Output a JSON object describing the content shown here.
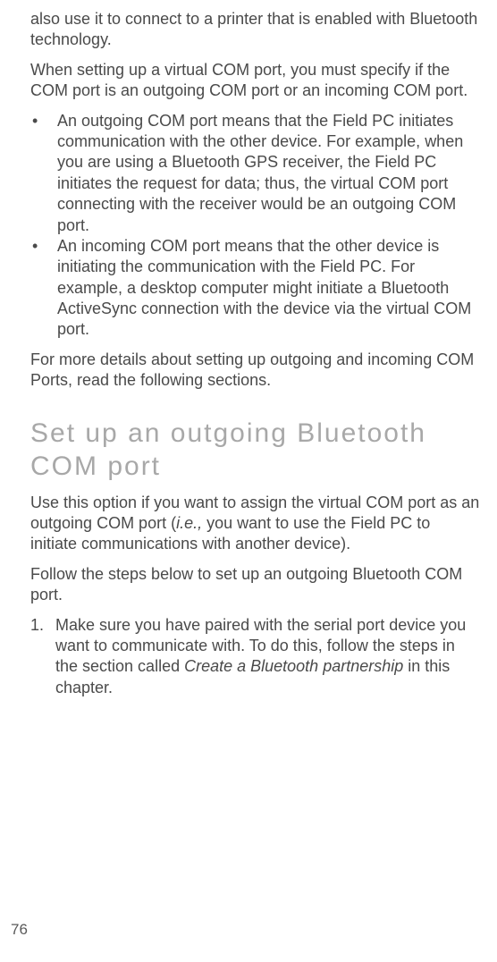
{
  "intro": {
    "p1": "also use it to connect to a printer that is enabled with Bluetooth technology.",
    "p2": "When setting up a virtual COM port, you must specify if the COM port is an outgoing COM port or an incoming COM port."
  },
  "bullets": [
    "An outgoing COM port means that the Field PC initiates communication with the other device. For example, when you are using a Bluetooth GPS receiver, the Field PC initiates the request for data; thus, the virtual COM port connecting with the receiver would be an outgoing COM port.",
    "An incoming COM port means that the other device is initiating the communication with the Field PC. For example, a desktop computer might initiate a Bluetooth ActiveSync connection with the device via the virtual COM port."
  ],
  "after_bullets": "For more details about setting up outgoing and incoming COM Ports, read the following sections.",
  "heading": "Set up an outgoing Bluetooth COM port",
  "section": {
    "p1_pre": "Use this option if you want to assign the virtual COM port as an outgoing COM port (",
    "p1_em": "i.e.,",
    "p1_post": " you want to use the Field PC to initiate communications with another device).",
    "p2": "Follow the steps below to set up an outgoing Bluetooth COM port."
  },
  "steps": {
    "s1_pre": "Make sure you have paired with the serial port device you want to communicate with. To do this, follow the steps in the section called ",
    "s1_em": "Create a Bluetooth partnership",
    "s1_post": " in this chapter."
  },
  "page_number": "76"
}
